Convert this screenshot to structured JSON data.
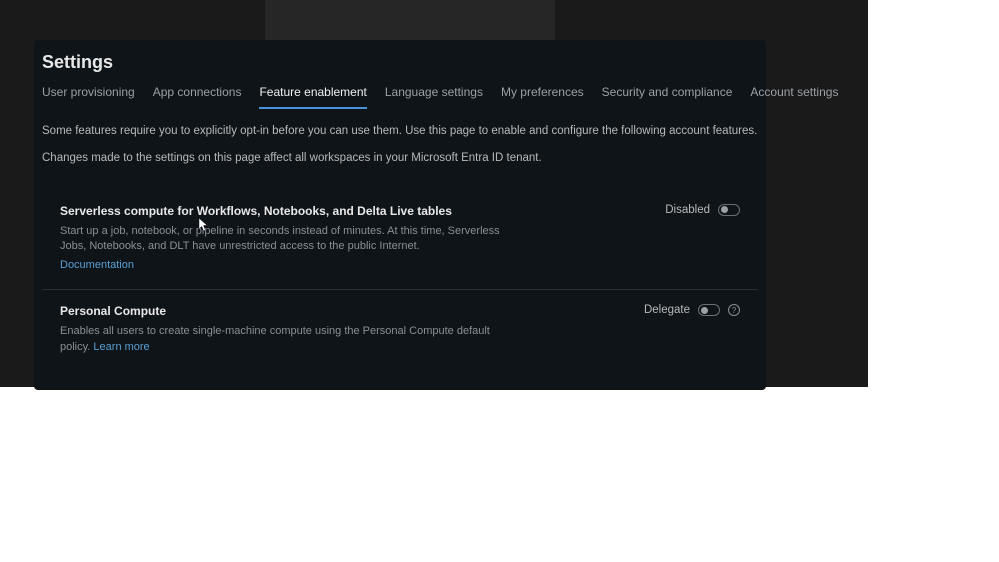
{
  "modal": {
    "title": "Settings",
    "tabs": [
      {
        "label": "User provisioning",
        "active": false
      },
      {
        "label": "App connections",
        "active": false
      },
      {
        "label": "Feature enablement",
        "active": true
      },
      {
        "label": "Language settings",
        "active": false
      },
      {
        "label": "My preferences",
        "active": false
      },
      {
        "label": "Security and compliance",
        "active": false
      },
      {
        "label": "Account settings",
        "active": false
      }
    ],
    "description_line1": "Some features require you to explicitly opt-in before you can use them. Use this page to enable and configure the following account features.",
    "description_line2": "Changes made to the settings on this page affect all workspaces in your Microsoft Entra ID tenant.",
    "features": [
      {
        "title": "Serverless compute for Workflows, Notebooks, and Delta Live tables",
        "description": "Start up a job, notebook, or pipeline in seconds instead of minutes. At this time, Serverless Jobs, Notebooks, and DLT have unrestricted access to the public Internet.",
        "link_label": "Documentation",
        "status_label": "Disabled",
        "toggle_state": "off",
        "has_info": false
      },
      {
        "title": "Personal Compute",
        "description": "Enables all users to create single-machine compute using the Personal Compute default policy. ",
        "link_label": "Learn more",
        "status_label": "Delegate",
        "toggle_state": "off",
        "has_info": true
      }
    ]
  }
}
